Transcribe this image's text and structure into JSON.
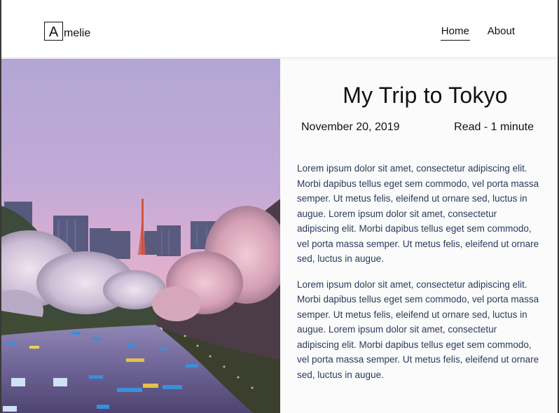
{
  "header": {
    "logo_initial": "A",
    "logo_rest": "melie",
    "nav": [
      {
        "label": "Home",
        "active": true
      },
      {
        "label": "About",
        "active": false
      }
    ]
  },
  "hero": {
    "icon": "tokyo-river-cherry-blossom-photo"
  },
  "article": {
    "title": "My Trip to Tokyo",
    "date": "November 20, 2019",
    "read_time": "Read - 1 minute",
    "paragraphs": [
      "Lorem ipsum dolor sit amet, consectetur adipiscing elit. Morbi dapibus tellus eget sem commodo, vel porta massa semper. Ut metus felis, eleifend ut ornare sed, luctus in augue. Lorem ipsum dolor sit amet, consectetur adipiscing elit. Morbi dapibus tellus eget sem commodo, vel porta massa semper. Ut metus felis, eleifend ut ornare sed, luctus in augue.",
      "Lorem ipsum dolor sit amet, consectetur adipiscing elit. Morbi dapibus tellus eget sem commodo, vel porta massa semper. Ut metus felis, eleifend ut ornare sed, luctus in augue. Lorem ipsum dolor sit amet, consectetur adipiscing elit. Morbi dapibus tellus eget sem commodo, vel porta massa semper. Ut metus felis, eleifend ut ornare sed, luctus in augue."
    ]
  },
  "colors": {
    "text": "#111111",
    "body_text": "#2b3a5c",
    "article_bg": "#fbfbfb",
    "sky_top": "#b7a9d6",
    "sky_bottom": "#e8b0c4"
  }
}
